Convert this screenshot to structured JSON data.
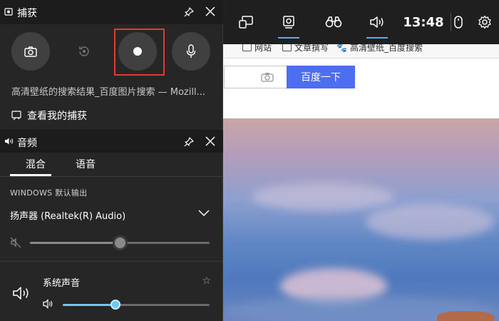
{
  "browser": {
    "bookmarks": [
      {
        "label": "网站"
      },
      {
        "label": "文章撰写"
      },
      {
        "label": "高清壁纸_百度搜索"
      }
    ],
    "search_button": "百度一下"
  },
  "topbar": {
    "clock": "13:48",
    "items": [
      "widget-menu",
      "capture",
      "performance",
      "audio",
      "mouse",
      "settings"
    ]
  },
  "capture": {
    "title": "捕获",
    "buttons": [
      "screenshot",
      "record-last-30s",
      "start-recording",
      "microphone"
    ],
    "window_title": "高清壁纸的搜索结果_百度图片搜索 — Mozill...",
    "link": "查看我的捕获"
  },
  "audio": {
    "title": "音频",
    "tabs": [
      {
        "label": "混合"
      },
      {
        "label": "语音"
      }
    ],
    "section": "WINDOWS 默认输出",
    "device": "扬声器 (Realtek(R) Audio)",
    "master_volume": 0.5,
    "app_name": "系统声音",
    "app_volume": 0.36
  },
  "colors": {
    "accent": "#4cb6f5",
    "highlight": "#e53935",
    "search_button": "#4e6ef2"
  }
}
